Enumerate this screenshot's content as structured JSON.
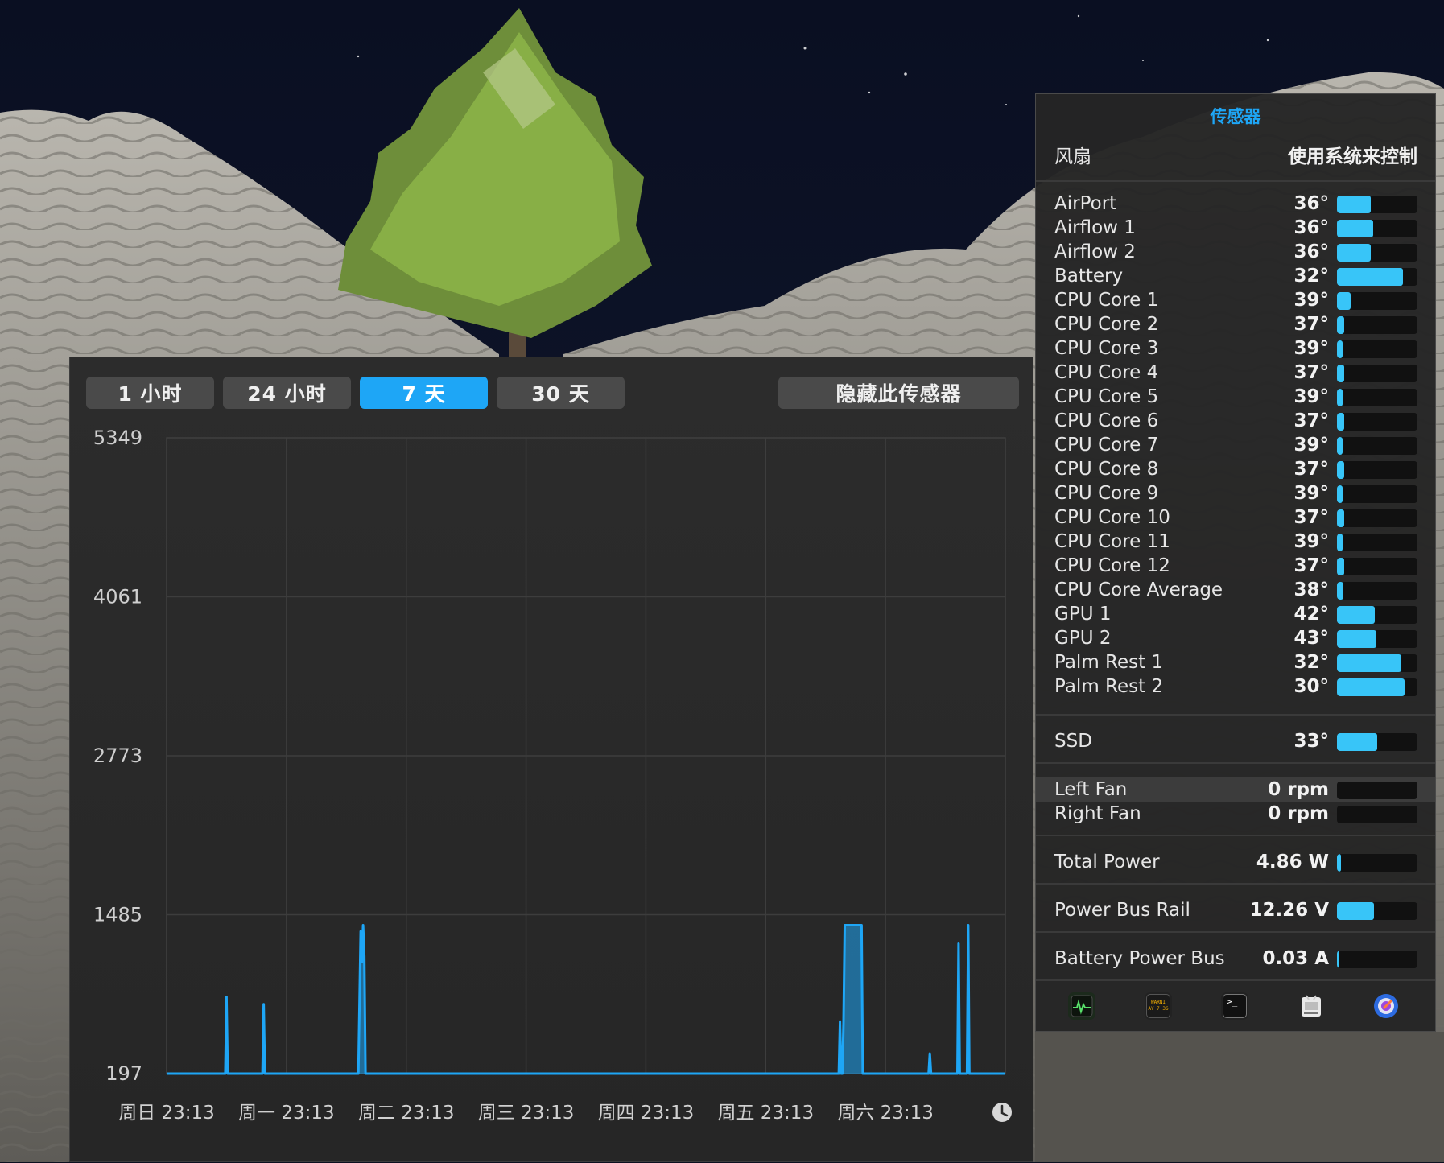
{
  "wallpaper": {
    "sky_color": "#0b1022",
    "rock_color": "#9a9891"
  },
  "chart_window": {
    "range_buttons": [
      {
        "label": "1 小时",
        "active": false
      },
      {
        "label": "24 小时",
        "active": false
      },
      {
        "label": "7 天",
        "active": true
      },
      {
        "label": "30 天",
        "active": false
      }
    ],
    "hide_button_label": "隐藏此传感器",
    "clock_icon": "clock-icon"
  },
  "chart_data": {
    "type": "line",
    "series": [
      {
        "color": "#1ea6f6",
        "x": [
          0,
          0.49,
          0.5,
          0.51,
          0.8,
          0.81,
          0.82,
          1.6,
          1.62,
          1.63,
          1.64,
          1.65,
          1.66,
          1.67,
          1.68,
          5.6,
          5.61,
          5.62,
          5.63,
          5.64,
          5.65,
          5.66,
          5.67,
          5.68,
          5.7,
          5.8,
          5.81,
          5.82,
          5.83,
          6.36,
          6.37,
          6.38,
          6.6,
          6.61,
          6.62,
          6.68,
          6.69,
          6.7,
          6.71,
          7.0
        ],
        "y": [
          197,
          197,
          820,
          197,
          197,
          760,
          197,
          197,
          1350,
          1100,
          1400,
          1150,
          197,
          197,
          197,
          197,
          197,
          620,
          197,
          197,
          620,
          1400,
          1400,
          1400,
          1400,
          1400,
          197,
          197,
          197,
          197,
          360,
          197,
          197,
          1250,
          197,
          197,
          1400,
          197,
          197,
          197
        ]
      }
    ],
    "yticks": [
      "5349",
      "4061",
      "2773",
      "1485",
      "197"
    ],
    "ylim": [
      197,
      5349
    ],
    "xticks": [
      "周日 23:13",
      "周一 23:13",
      "周二 23:13",
      "周三 23:13",
      "周四 23:13",
      "周五 23:13",
      "周六 23:13"
    ],
    "xlim": [
      0,
      7
    ],
    "grid": true
  },
  "sensors": {
    "title": "传感器",
    "fan_label": "风扇",
    "fan_control": "使用系统来控制",
    "temperatures": [
      {
        "name": "AirPort",
        "value": "36°",
        "level": 0.42
      },
      {
        "name": "Airflow 1",
        "value": "36°",
        "level": 0.45
      },
      {
        "name": "Airflow 2",
        "value": "36°",
        "level": 0.42
      },
      {
        "name": "Battery",
        "value": "32°",
        "level": 0.82
      },
      {
        "name": "CPU Core 1",
        "value": "39°",
        "level": 0.17
      },
      {
        "name": "CPU Core 2",
        "value": "37°",
        "level": 0.09
      },
      {
        "name": "CPU Core 3",
        "value": "39°",
        "level": 0.07
      },
      {
        "name": "CPU Core 4",
        "value": "37°",
        "level": 0.09
      },
      {
        "name": "CPU Core 5",
        "value": "39°",
        "level": 0.07
      },
      {
        "name": "CPU Core 6",
        "value": "37°",
        "level": 0.09
      },
      {
        "name": "CPU Core 7",
        "value": "39°",
        "level": 0.07
      },
      {
        "name": "CPU Core 8",
        "value": "37°",
        "level": 0.09
      },
      {
        "name": "CPU Core 9",
        "value": "39°",
        "level": 0.07
      },
      {
        "name": "CPU Core 10",
        "value": "37°",
        "level": 0.09
      },
      {
        "name": "CPU Core 11",
        "value": "39°",
        "level": 0.07
      },
      {
        "name": "CPU Core 12",
        "value": "37°",
        "level": 0.09
      },
      {
        "name": "CPU Core Average",
        "value": "38°",
        "level": 0.08
      },
      {
        "name": "GPU 1",
        "value": "42°",
        "level": 0.47
      },
      {
        "name": "GPU 2",
        "value": "43°",
        "level": 0.49
      },
      {
        "name": "Palm Rest 1",
        "value": "32°",
        "level": 0.8
      },
      {
        "name": "Palm Rest 2",
        "value": "30°",
        "level": 0.84
      }
    ],
    "ssd": {
      "name": "SSD",
      "value": "33°",
      "level": 0.5
    },
    "fans": [
      {
        "name": "Left Fan",
        "value": "0 rpm",
        "level": 0
      },
      {
        "name": "Right Fan",
        "value": "0 rpm",
        "level": 0
      }
    ],
    "power": [
      {
        "name": "Total Power",
        "value": "4.86 W",
        "level": 0.05
      },
      {
        "name": "Power Bus Rail",
        "value": "12.26 V",
        "level": 0.46
      },
      {
        "name": "Battery Power Bus",
        "value": "0.03 A",
        "level": 0.02
      }
    ],
    "apps": [
      {
        "icon": "activity-monitor-icon"
      },
      {
        "icon": "console-icon",
        "text": "WARNI\nAY 7:36"
      },
      {
        "icon": "terminal-icon",
        "text": ">_"
      },
      {
        "icon": "system-information-icon"
      },
      {
        "icon": "disk-utility-icon"
      }
    ]
  }
}
